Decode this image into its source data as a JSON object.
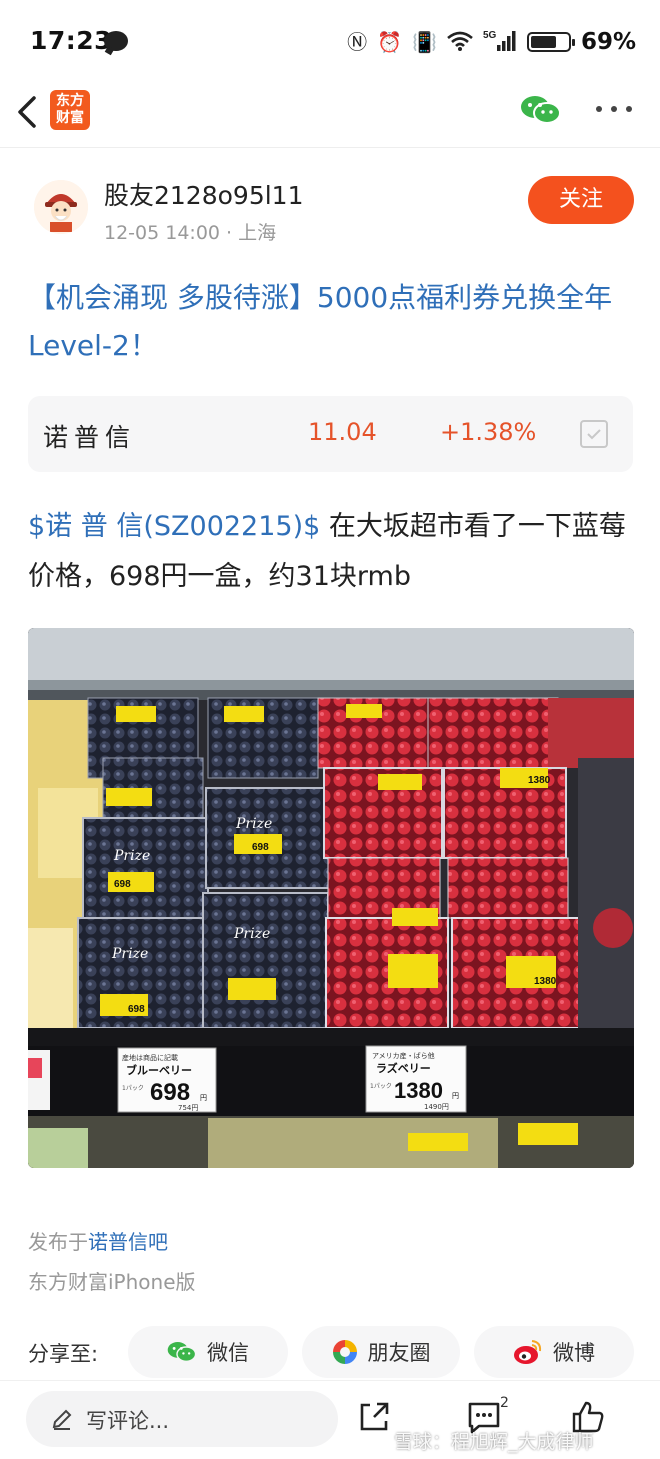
{
  "status_bar": {
    "time": "17:23",
    "network": "5G",
    "battery_pct": "69%",
    "battery_level": 0.69
  },
  "nav": {
    "logo_line1": "东方",
    "logo_line2": "财富"
  },
  "author": {
    "name": "股友2128o95l11",
    "meta": "12-05 14:00 · 上海",
    "follow_label": "关注"
  },
  "post": {
    "title": "【机会涌现 多股待涨】5000点福利券兑换全年Level-2！",
    "stock_card": {
      "name": "诺普信",
      "price": "11.04",
      "change": "+1.38%"
    },
    "body_tag": "$诺 普 信(SZ002215)$",
    "body_text": " 在大坂超市看了一下蓝莓价格，698円一盒，约31块rmb",
    "image": {
      "left_tag_head": "産地は商品に記載",
      "left_tag_name": "ブルーベリー",
      "left_tag_pack": "1パック",
      "left_price": "698",
      "left_price_yen": "円",
      "left_tax": "754円",
      "right_tag_head": "アメリカ産・ばら他",
      "right_tag_name": "ラズベリー",
      "right_tag_pack": "1パック",
      "right_price": "1380",
      "right_price_yen": "円",
      "right_tax": "1490円",
      "brand": "Prize",
      "small_label": "698",
      "small_label2": "1380"
    }
  },
  "meta": {
    "published_prefix": "发布于",
    "bar_name": "诺普信吧",
    "client": "东方财富iPhone版"
  },
  "share": {
    "label": "分享至:",
    "wechat": "微信",
    "moments": "朋友圈",
    "weibo": "微博"
  },
  "bottom": {
    "comment_placeholder": "写评论...",
    "comment_count": "2",
    "watermark": "雪球：程旭辉_大成律师"
  },
  "colors": {
    "accent": "#f4511e",
    "link": "#2f6fb8",
    "up": "#e5532a"
  }
}
